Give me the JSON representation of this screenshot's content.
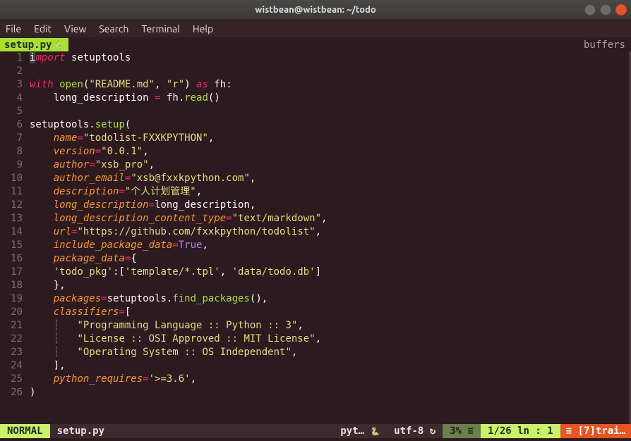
{
  "window": {
    "title": "wistbean@wistbean: ~/todo"
  },
  "menu": {
    "items": [
      "File",
      "Edit",
      "View",
      "Search",
      "Terminal",
      "Help"
    ]
  },
  "tab": {
    "name": "setup.py",
    "right_label": "buffers"
  },
  "status": {
    "mode": "NORMAL",
    "file": "setup.py",
    "filetype": "pyt…",
    "encoding": "utf-8",
    "percent": "3%",
    "position": "1/26 ln : 1",
    "extra": "[7]trai…"
  },
  "code": {
    "lines": [
      {
        "n": 1,
        "segs": [
          {
            "c": "cursor",
            "t": "i"
          },
          {
            "c": "kw",
            "t": "mport"
          },
          {
            "c": "pun",
            "t": " "
          },
          {
            "c": "obj",
            "t": "setuptools"
          }
        ]
      },
      {
        "n": 2,
        "segs": []
      },
      {
        "n": 3,
        "segs": [
          {
            "c": "kw",
            "t": "with"
          },
          {
            "c": "pun",
            "t": " "
          },
          {
            "c": "fn",
            "t": "open"
          },
          {
            "c": "pun",
            "t": "("
          },
          {
            "c": "str",
            "t": "\"README.md\""
          },
          {
            "c": "pun",
            "t": ", "
          },
          {
            "c": "str",
            "t": "\"r\""
          },
          {
            "c": "pun",
            "t": ") "
          },
          {
            "c": "kw",
            "t": "as"
          },
          {
            "c": "pun",
            "t": " "
          },
          {
            "c": "obj",
            "t": "fh"
          },
          {
            "c": "pun",
            "t": ":"
          }
        ]
      },
      {
        "n": 4,
        "segs": [
          {
            "c": "pun",
            "t": "    "
          },
          {
            "c": "obj",
            "t": "long_description"
          },
          {
            "c": "pun",
            "t": " "
          },
          {
            "c": "op",
            "t": "="
          },
          {
            "c": "pun",
            "t": " "
          },
          {
            "c": "obj",
            "t": "fh"
          },
          {
            "c": "pun",
            "t": "."
          },
          {
            "c": "fn",
            "t": "read"
          },
          {
            "c": "pun",
            "t": "()"
          }
        ]
      },
      {
        "n": 5,
        "segs": []
      },
      {
        "n": 6,
        "segs": [
          {
            "c": "obj",
            "t": "setuptools"
          },
          {
            "c": "pun",
            "t": "."
          },
          {
            "c": "fn",
            "t": "setup"
          },
          {
            "c": "pun",
            "t": "("
          }
        ]
      },
      {
        "n": 7,
        "segs": [
          {
            "c": "pun",
            "t": "    "
          },
          {
            "c": "arg",
            "t": "name"
          },
          {
            "c": "op",
            "t": "="
          },
          {
            "c": "str",
            "t": "\"todolist-FXXKPYTHON\""
          },
          {
            "c": "pun",
            "t": ","
          }
        ]
      },
      {
        "n": 8,
        "segs": [
          {
            "c": "pun",
            "t": "    "
          },
          {
            "c": "arg",
            "t": "version"
          },
          {
            "c": "op",
            "t": "="
          },
          {
            "c": "str",
            "t": "\"0.0.1\""
          },
          {
            "c": "pun",
            "t": ","
          }
        ]
      },
      {
        "n": 9,
        "segs": [
          {
            "c": "pun",
            "t": "    "
          },
          {
            "c": "arg",
            "t": "author"
          },
          {
            "c": "op",
            "t": "="
          },
          {
            "c": "str",
            "t": "\"xsb_pro\""
          },
          {
            "c": "pun",
            "t": ","
          }
        ]
      },
      {
        "n": 10,
        "segs": [
          {
            "c": "pun",
            "t": "    "
          },
          {
            "c": "arg",
            "t": "author_email"
          },
          {
            "c": "op",
            "t": "="
          },
          {
            "c": "str",
            "t": "\"xsb@fxxkpython.com\""
          },
          {
            "c": "pun",
            "t": ","
          }
        ]
      },
      {
        "n": 11,
        "segs": [
          {
            "c": "pun",
            "t": "    "
          },
          {
            "c": "arg",
            "t": "description"
          },
          {
            "c": "op",
            "t": "="
          },
          {
            "c": "str",
            "t": "\"个人计划管理\""
          },
          {
            "c": "pun",
            "t": ","
          }
        ]
      },
      {
        "n": 12,
        "segs": [
          {
            "c": "pun",
            "t": "    "
          },
          {
            "c": "arg",
            "t": "long_description"
          },
          {
            "c": "op",
            "t": "="
          },
          {
            "c": "obj",
            "t": "long_description"
          },
          {
            "c": "pun",
            "t": ","
          }
        ]
      },
      {
        "n": 13,
        "segs": [
          {
            "c": "pun",
            "t": "    "
          },
          {
            "c": "arg",
            "t": "long_description_content_type"
          },
          {
            "c": "op",
            "t": "="
          },
          {
            "c": "str",
            "t": "\"text/markdown\""
          },
          {
            "c": "pun",
            "t": ","
          }
        ]
      },
      {
        "n": 14,
        "segs": [
          {
            "c": "pun",
            "t": "    "
          },
          {
            "c": "arg",
            "t": "url"
          },
          {
            "c": "op",
            "t": "="
          },
          {
            "c": "str",
            "t": "\"https://github.com/fxxkpython/todolist\""
          },
          {
            "c": "pun",
            "t": ","
          }
        ]
      },
      {
        "n": 15,
        "segs": [
          {
            "c": "pun",
            "t": "    "
          },
          {
            "c": "arg",
            "t": "include_package_data"
          },
          {
            "c": "op",
            "t": "="
          },
          {
            "c": "const",
            "t": "True"
          },
          {
            "c": "pun",
            "t": ","
          }
        ]
      },
      {
        "n": 16,
        "segs": [
          {
            "c": "pun",
            "t": "    "
          },
          {
            "c": "arg",
            "t": "package_data"
          },
          {
            "c": "op",
            "t": "="
          },
          {
            "c": "pun",
            "t": "{"
          }
        ]
      },
      {
        "n": 17,
        "segs": [
          {
            "c": "pun",
            "t": "    "
          },
          {
            "c": "str",
            "t": "'todo_pkg'"
          },
          {
            "c": "pun",
            "t": ":["
          },
          {
            "c": "str",
            "t": "'template/*.tpl'"
          },
          {
            "c": "pun",
            "t": ", "
          },
          {
            "c": "str",
            "t": "'data/todo.db'"
          },
          {
            "c": "pun",
            "t": "]"
          }
        ]
      },
      {
        "n": 18,
        "segs": [
          {
            "c": "pun",
            "t": "    },"
          }
        ]
      },
      {
        "n": 19,
        "segs": [
          {
            "c": "pun",
            "t": "    "
          },
          {
            "c": "arg",
            "t": "packages"
          },
          {
            "c": "op",
            "t": "="
          },
          {
            "c": "obj",
            "t": "setuptools"
          },
          {
            "c": "pun",
            "t": "."
          },
          {
            "c": "fn",
            "t": "find_packages"
          },
          {
            "c": "pun",
            "t": "(),"
          }
        ]
      },
      {
        "n": 20,
        "segs": [
          {
            "c": "pun",
            "t": "    "
          },
          {
            "c": "arg",
            "t": "classifiers"
          },
          {
            "c": "op",
            "t": "="
          },
          {
            "c": "pun",
            "t": "["
          }
        ]
      },
      {
        "n": 21,
        "segs": [
          {
            "c": "dim",
            "t": "    ┆   "
          },
          {
            "c": "str",
            "t": "\"Programming Language :: Python :: 3\""
          },
          {
            "c": "pun",
            "t": ","
          }
        ]
      },
      {
        "n": 22,
        "segs": [
          {
            "c": "dim",
            "t": "    ┆   "
          },
          {
            "c": "str",
            "t": "\"License :: OSI Approved :: MIT License\""
          },
          {
            "c": "pun",
            "t": ","
          }
        ]
      },
      {
        "n": 23,
        "segs": [
          {
            "c": "dim",
            "t": "    ┆   "
          },
          {
            "c": "str",
            "t": "\"Operating System :: OS Independent\""
          },
          {
            "c": "pun",
            "t": ","
          }
        ]
      },
      {
        "n": 24,
        "segs": [
          {
            "c": "pun",
            "t": "    ],"
          }
        ]
      },
      {
        "n": 25,
        "segs": [
          {
            "c": "pun",
            "t": "    "
          },
          {
            "c": "arg",
            "t": "python_requires"
          },
          {
            "c": "op",
            "t": "="
          },
          {
            "c": "str",
            "t": "'>=3.6'"
          },
          {
            "c": "pun",
            "t": ","
          }
        ]
      },
      {
        "n": 26,
        "segs": [
          {
            "c": "pun",
            "t": ")"
          }
        ]
      }
    ]
  }
}
